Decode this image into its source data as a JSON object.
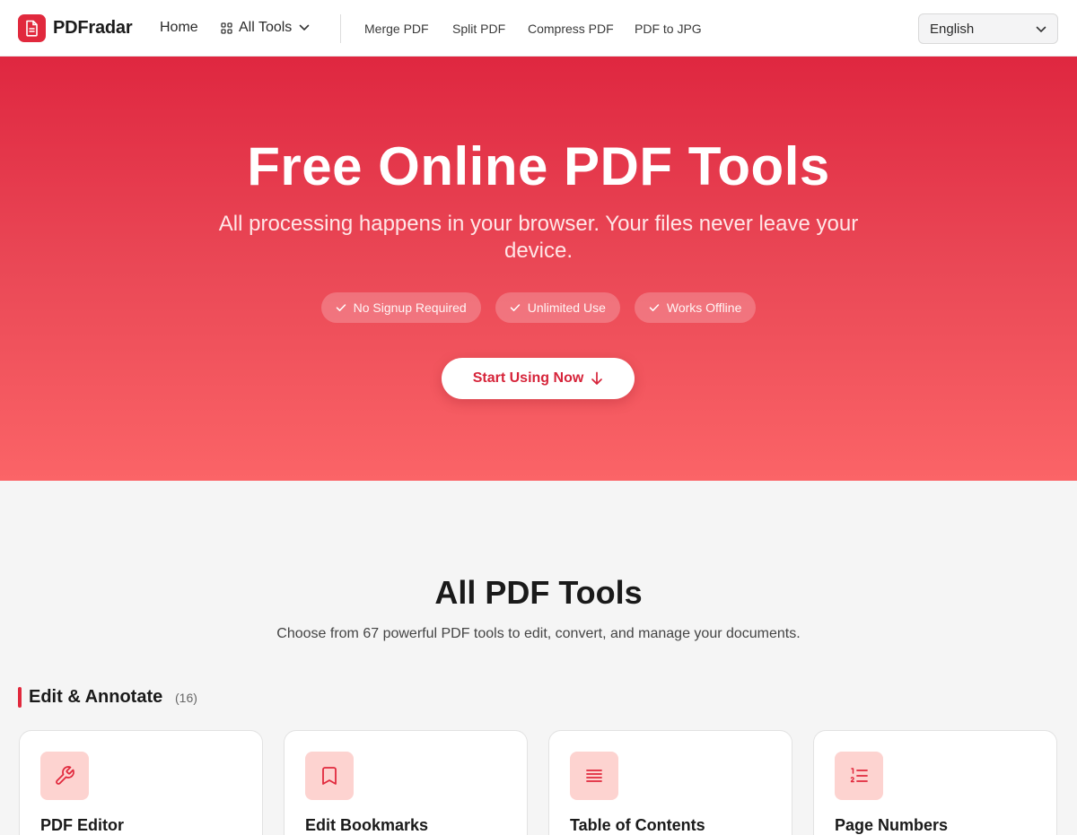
{
  "header": {
    "brand": "PDFradar",
    "nav": {
      "home": "Home",
      "all_tools": "All Tools",
      "links": [
        "Merge PDF",
        "Split PDF",
        "Compress PDF",
        "PDF to JPG"
      ]
    },
    "language": "English"
  },
  "hero": {
    "title": "Free Online PDF Tools",
    "subtitle": "All processing happens in your browser. Your files never leave your device.",
    "badges": [
      "No Signup Required",
      "Unlimited Use",
      "Works Offline"
    ],
    "cta": "Start Using Now"
  },
  "tools_section": {
    "title": "All PDF Tools",
    "description": "Choose from 67 powerful PDF tools to edit, convert, and manage your documents.",
    "category": {
      "name": "Edit & Annotate",
      "count": "(16)",
      "cards": [
        {
          "title": "PDF Editor",
          "icon": "wrench-icon"
        },
        {
          "title": "Edit Bookmarks",
          "icon": "bookmark-icon"
        },
        {
          "title": "Table of Contents",
          "icon": "list-lines-icon"
        },
        {
          "title": "Page Numbers",
          "icon": "numbered-list-icon"
        }
      ]
    }
  },
  "colors": {
    "brand": "#e1293d",
    "hero_top": "#df2740",
    "hero_bottom": "#fb6467",
    "icon_tile": "#fdd3d0"
  }
}
